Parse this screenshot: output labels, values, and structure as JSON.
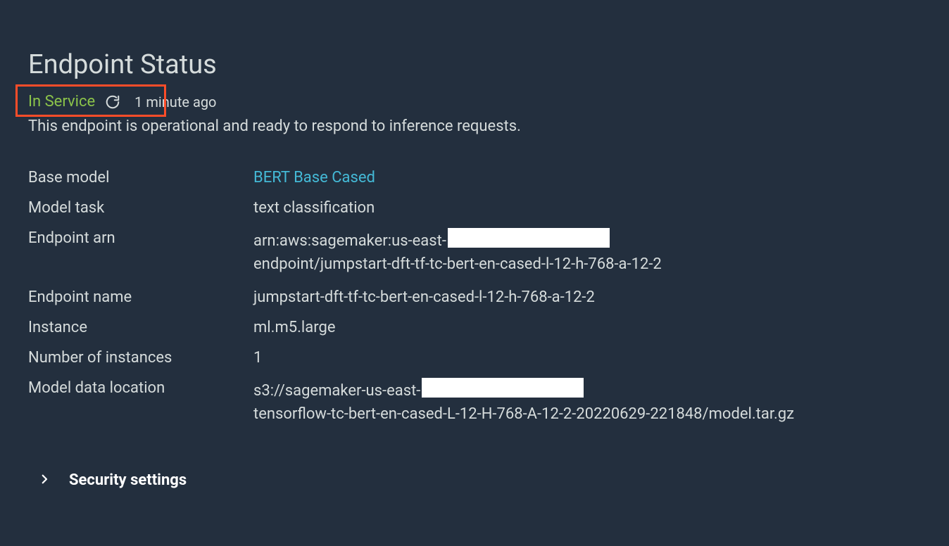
{
  "header": {
    "title": "Endpoint Status",
    "status": "In Service",
    "timestamp": "1 minute ago",
    "description": "This endpoint is operational and ready to respond to inference requests."
  },
  "details": {
    "base_model_label": "Base model",
    "base_model_value": "BERT Base Cased",
    "model_task_label": "Model task",
    "model_task_value": "text classification",
    "endpoint_arn_label": "Endpoint arn",
    "endpoint_arn_prefix": "arn:aws:sagemaker:us-east-",
    "endpoint_arn_suffix": "endpoint/jumpstart-dft-tf-tc-bert-en-cased-l-12-h-768-a-12-2",
    "endpoint_name_label": "Endpoint name",
    "endpoint_name_value": "jumpstart-dft-tf-tc-bert-en-cased-l-12-h-768-a-12-2",
    "instance_label": "Instance",
    "instance_value": "ml.m5.large",
    "num_instances_label": "Number of instances",
    "num_instances_value": "1",
    "model_data_label": "Model data location",
    "model_data_prefix": "s3://sagemaker-us-east-",
    "model_data_suffix": "tensorflow-tc-bert-en-cased-L-12-H-768-A-12-2-20220629-221848/model.tar.gz"
  },
  "security": {
    "label": "Security settings"
  }
}
